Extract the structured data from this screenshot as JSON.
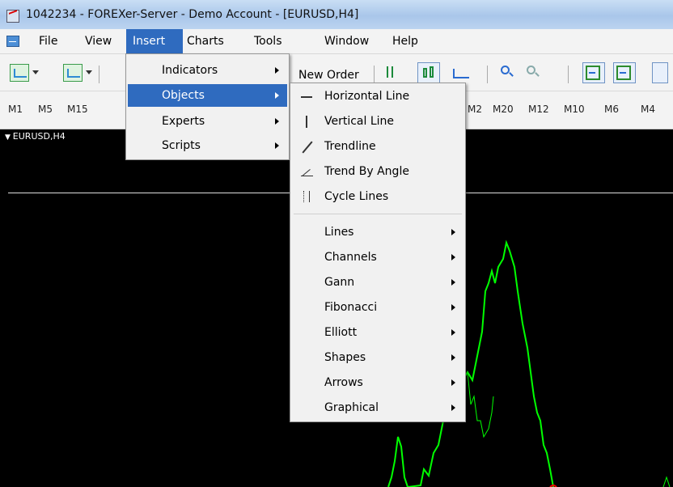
{
  "window": {
    "title": "1042234 - FOREXer-Server - Demo Account - [EURUSD,H4]"
  },
  "menubar": {
    "items": [
      {
        "label": "File",
        "active": false
      },
      {
        "label": "View",
        "active": false
      },
      {
        "label": "Insert",
        "active": true
      },
      {
        "label": "Charts",
        "active": false
      },
      {
        "label": "Tools",
        "active": false
      },
      {
        "label": "Window",
        "active": false
      },
      {
        "label": "Help",
        "active": false
      }
    ]
  },
  "toolbar": {
    "new_order_label": "New Order"
  },
  "timeframes": [
    "M1",
    "M5",
    "M15",
    "M2",
    "M20",
    "M12",
    "M10",
    "M6",
    "M4"
  ],
  "chart": {
    "label": "EURUSD,H4",
    "price_color": "#00ff00",
    "background": "#000000"
  },
  "insert_menu": {
    "items": [
      {
        "label": "Indicators",
        "highlight": false
      },
      {
        "label": "Objects",
        "highlight": true
      },
      {
        "label": "Experts",
        "highlight": false
      },
      {
        "label": "Scripts",
        "highlight": false
      }
    ]
  },
  "objects_menu": {
    "items": [
      {
        "label": "Horizontal Line",
        "icon": "horizontal-line-icon"
      },
      {
        "label": "Vertical Line",
        "icon": "vertical-line-icon"
      },
      {
        "label": "Trendline",
        "icon": "trendline-icon"
      },
      {
        "label": "Trend By Angle",
        "icon": "trend-by-angle-icon"
      },
      {
        "label": "Cycle Lines",
        "icon": "cycle-lines-icon"
      }
    ],
    "submenus": [
      {
        "label": "Lines"
      },
      {
        "label": "Channels"
      },
      {
        "label": "Gann"
      },
      {
        "label": "Fibonacci"
      },
      {
        "label": "Elliott"
      },
      {
        "label": "Shapes"
      },
      {
        "label": "Arrows"
      },
      {
        "label": "Graphical"
      }
    ]
  },
  "colors": {
    "menu_highlight": "#2f6bbf",
    "menu_bg": "#f1f1f1",
    "titlebar": "#a9c6ea"
  }
}
